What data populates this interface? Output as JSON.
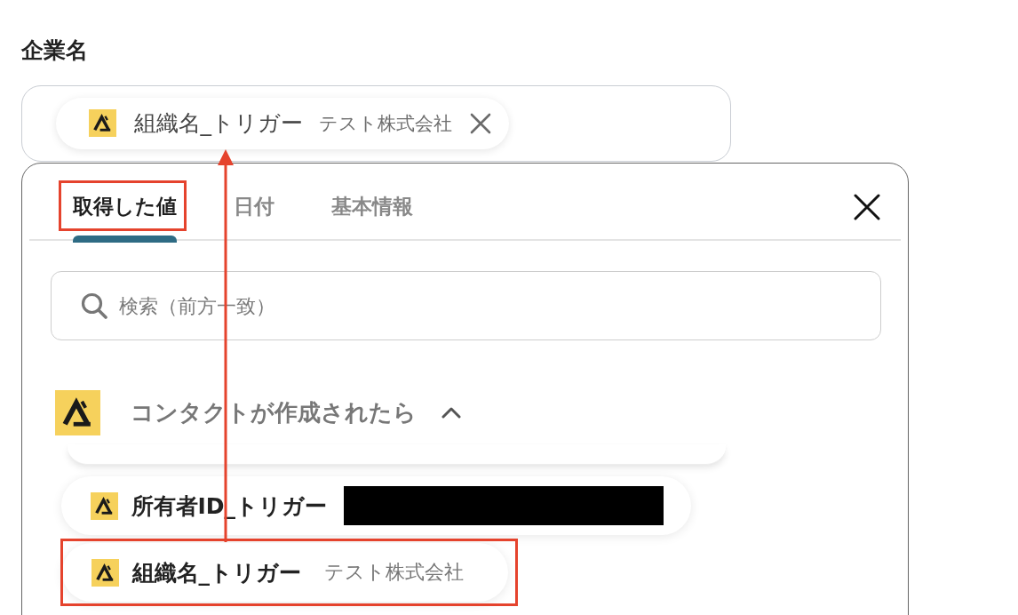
{
  "field": {
    "label": "企業名",
    "chip": {
      "label": "組織名_トリガー",
      "value": "テスト株式会社"
    }
  },
  "panel": {
    "tabs": [
      {
        "label": "取得した値",
        "selected": true,
        "highlighted": true
      },
      {
        "label": "日付",
        "selected": false,
        "highlighted": false
      },
      {
        "label": "基本情報",
        "selected": false,
        "highlighted": false
      }
    ],
    "search": {
      "placeholder": "検索（前方一致）"
    },
    "section": {
      "title": "コンタクトが作成されたら",
      "expanded": true,
      "items": [
        {
          "label": "所有者ID_トリガー",
          "redacted": true,
          "highlighted": false
        },
        {
          "label": "組織名_トリガー",
          "value": "テスト株式会社",
          "redacted": false,
          "highlighted": true
        }
      ]
    }
  }
}
